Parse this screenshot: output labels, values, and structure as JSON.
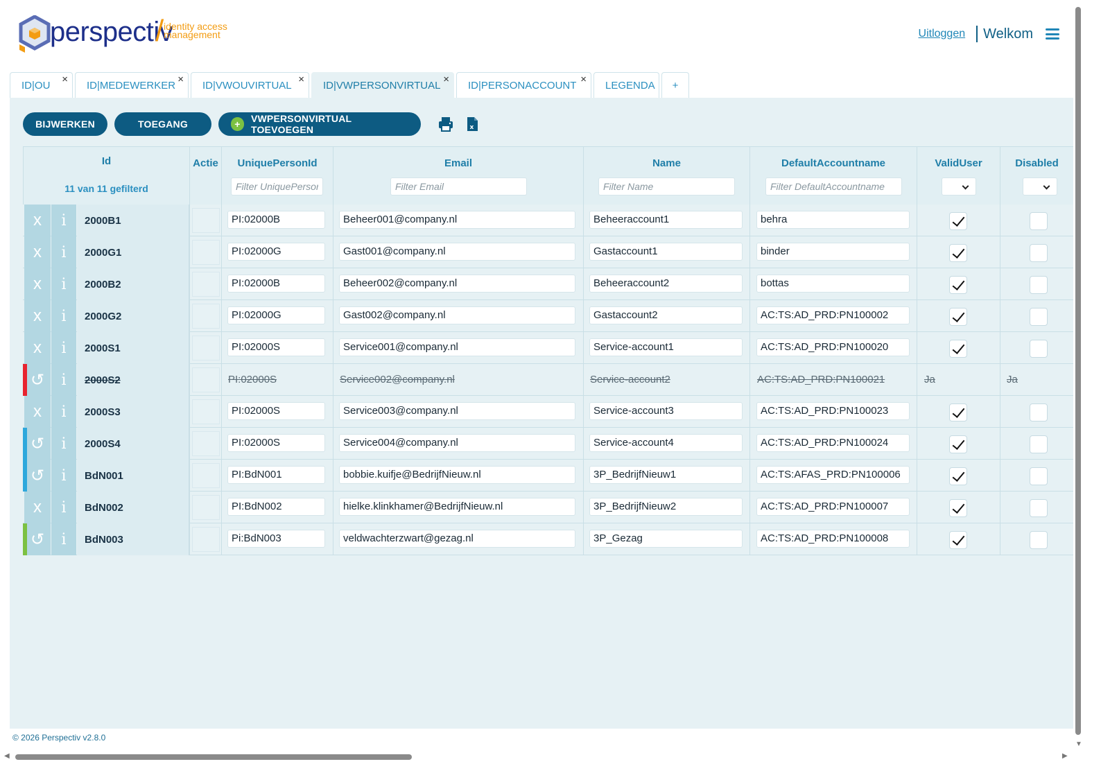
{
  "brand": {
    "name": "perspectiv",
    "tagline_1": "identity access",
    "tagline_2": "management"
  },
  "header": {
    "logout_label": "Uitloggen",
    "welcome_label": "Welkom",
    "menu_icon": "hamburger-menu-icon"
  },
  "tabs": [
    {
      "label": "ID|OU",
      "closable": true,
      "active": false
    },
    {
      "label": "ID|MEDEWERKER",
      "closable": true,
      "active": false
    },
    {
      "label": "ID|VWOUVIRTUAL",
      "closable": true,
      "active": false
    },
    {
      "label": "ID|VWPERSONVIRTUAL",
      "closable": true,
      "active": true
    },
    {
      "label": "ID|PERSONACCOUNT",
      "closable": true,
      "active": false
    },
    {
      "label": "LEGENDA",
      "closable": false,
      "active": false
    },
    {
      "label": "+",
      "closable": false,
      "active": false
    }
  ],
  "tab_close_glyph": "×",
  "toolbar": {
    "update_label": "BIJWERKEN",
    "access_label": "TOEGANG",
    "add_label": "VWPERSONVIRTUAL TOEVOEGEN",
    "add_icon_glyph": "+",
    "print_icon": "printer-icon",
    "excel_icon": "excel-export-icon"
  },
  "table": {
    "columns": {
      "id": "Id",
      "id_filter_status": "11 van 11 gefilterd",
      "actie": "Actie",
      "unique": "UniquePersonId",
      "email": "Email",
      "name": "Name",
      "account": "DefaultAccountname",
      "valid": "ValidUser",
      "disabled": "Disabled"
    },
    "filters": {
      "unique": "Filter UniquePersonId",
      "email": "Filter Email",
      "name": "Filter Name",
      "account": "Filter DefaultAccountname"
    },
    "delete_glyph": "x",
    "undo_glyph": "↺",
    "info_glyph": "i",
    "colors": {
      "flag_red": "#e8232f",
      "flag_blue": "#2ea8dc",
      "flag_green": "#7cc142"
    },
    "rows": [
      {
        "id": "2000B1",
        "unique": "PI:02000B",
        "email": "Beheer001@company.nl",
        "name": "Beheeraccount1",
        "account": "behra",
        "valid": true,
        "disabled": false,
        "action": "delete",
        "flag": "",
        "deleted": false
      },
      {
        "id": "2000G1",
        "unique": "PI:02000G",
        "email": "Gast001@company.nl",
        "name": "Gastaccount1",
        "account": "binder",
        "valid": true,
        "disabled": false,
        "action": "delete",
        "flag": "",
        "deleted": false
      },
      {
        "id": "2000B2",
        "unique": "PI:02000B",
        "email": "Beheer002@company.nl",
        "name": "Beheeraccount2",
        "account": "bottas",
        "valid": true,
        "disabled": false,
        "action": "delete",
        "flag": "",
        "deleted": false
      },
      {
        "id": "2000G2",
        "unique": "PI:02000G",
        "email": "Gast002@company.nl",
        "name": "Gastaccount2",
        "account": "AC:TS:AD_PRD:PN100002",
        "valid": true,
        "disabled": false,
        "action": "delete",
        "flag": "",
        "deleted": false
      },
      {
        "id": "2000S1",
        "unique": "PI:02000S",
        "email": "Service001@company.nl",
        "name": "Service-account1",
        "account": "AC:TS:AD_PRD:PN100020",
        "valid": true,
        "disabled": false,
        "action": "delete",
        "flag": "",
        "deleted": false
      },
      {
        "id": "2000S2",
        "unique": "PI:02000S",
        "email": "Service002@company.nl",
        "name": "Service-account2",
        "account": "AC:TS:AD_PRD:PN100021",
        "valid_text": "Ja",
        "disabled_text": "Ja",
        "action": "undo",
        "flag": "red",
        "deleted": true
      },
      {
        "id": "2000S3",
        "unique": "PI:02000S",
        "email": "Service003@company.nl",
        "name": "Service-account3",
        "account": "AC:TS:AD_PRD:PN100023",
        "valid": true,
        "disabled": false,
        "action": "delete",
        "flag": "",
        "deleted": false
      },
      {
        "id": "2000S4",
        "unique": "PI:02000S",
        "email": "Service004@company.nl",
        "name": "Service-account4",
        "account": "AC:TS:AD_PRD:PN100024",
        "valid": true,
        "disabled": false,
        "action": "undo",
        "flag": "blue",
        "deleted": false
      },
      {
        "id": "BdN001",
        "unique": "PI:BdN001",
        "email": "bobbie.kuifje@BedrijfNieuw.nl",
        "name": "3P_BedrijfNieuw1",
        "account": "AC:TS:AFAS_PRD:PN100006",
        "valid": true,
        "disabled": false,
        "action": "undo",
        "flag": "blue",
        "deleted": false
      },
      {
        "id": "BdN002",
        "unique": "PI:BdN002",
        "email": "hielke.klinkhamer@BedrijfNieuw.nl",
        "name": "3P_BedrijfNieuw2",
        "account": "AC:TS:AD_PRD:PN100007",
        "valid": true,
        "disabled": false,
        "action": "delete",
        "flag": "",
        "deleted": false
      },
      {
        "id": "BdN003",
        "unique": "Pi:BdN003",
        "email": "veldwachterzwart@gezag.nl",
        "name": "3P_Gezag",
        "account": "AC:TS:AD_PRD:PN100008",
        "valid": true,
        "disabled": false,
        "action": "undo",
        "flag": "green",
        "deleted": false
      }
    ]
  },
  "footer": {
    "copyright": "© 2026 Perspectiv v2.8.0"
  }
}
